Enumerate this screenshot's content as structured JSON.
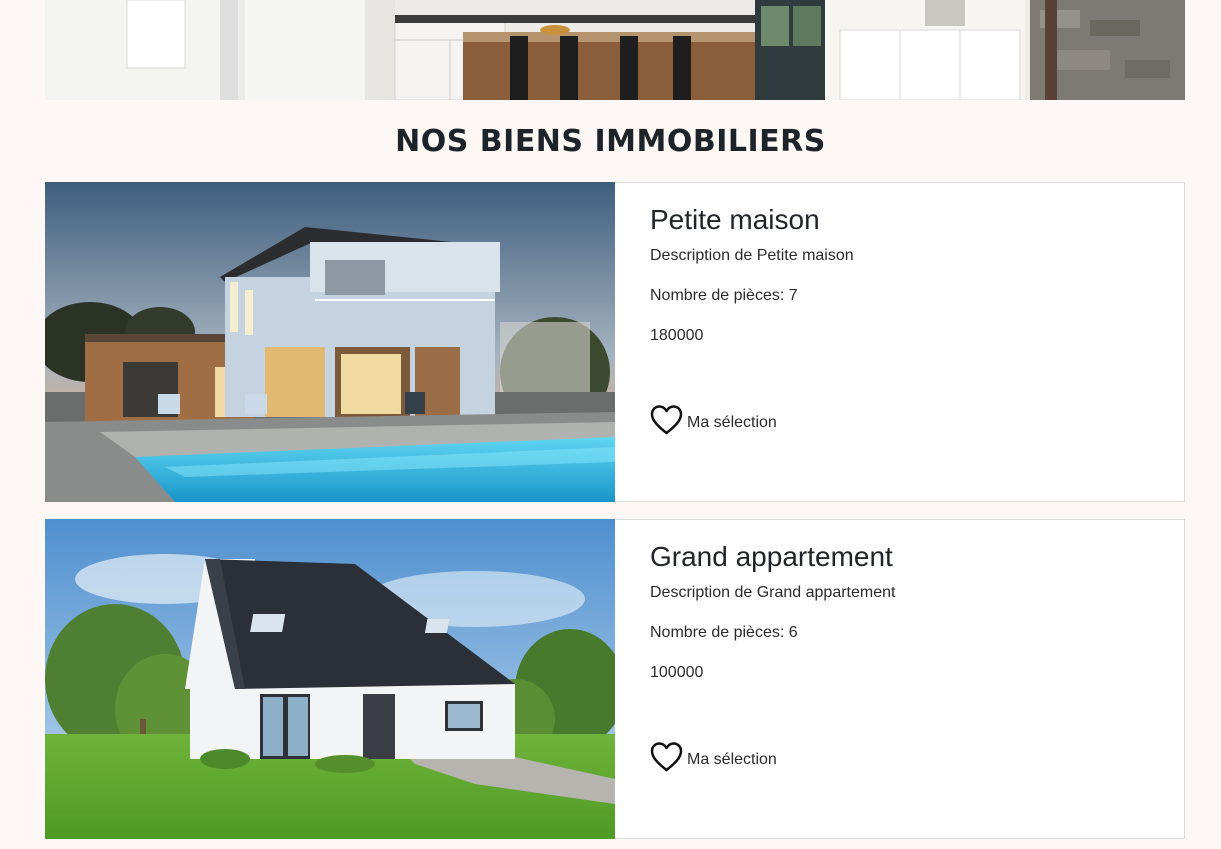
{
  "section": {
    "title": "NOS BIENS IMMOBILIERS"
  },
  "listings": [
    {
      "title": "Petite maison",
      "description": "Description de Petite maison",
      "rooms": "Nombre de pièces: 7",
      "price": "180000",
      "favorite_label": "Ma sélection"
    },
    {
      "title": "Grand appartement",
      "description": "Description de Grand appartement",
      "rooms": "Nombre de pièces: 6",
      "price": "100000",
      "favorite_label": "Ma sélection"
    }
  ],
  "icons": {
    "favorite": "heart-outline-icon"
  },
  "colors": {
    "page_background": "#fdf8f6",
    "card_border": "#dcdcdc",
    "text": "#212529"
  }
}
